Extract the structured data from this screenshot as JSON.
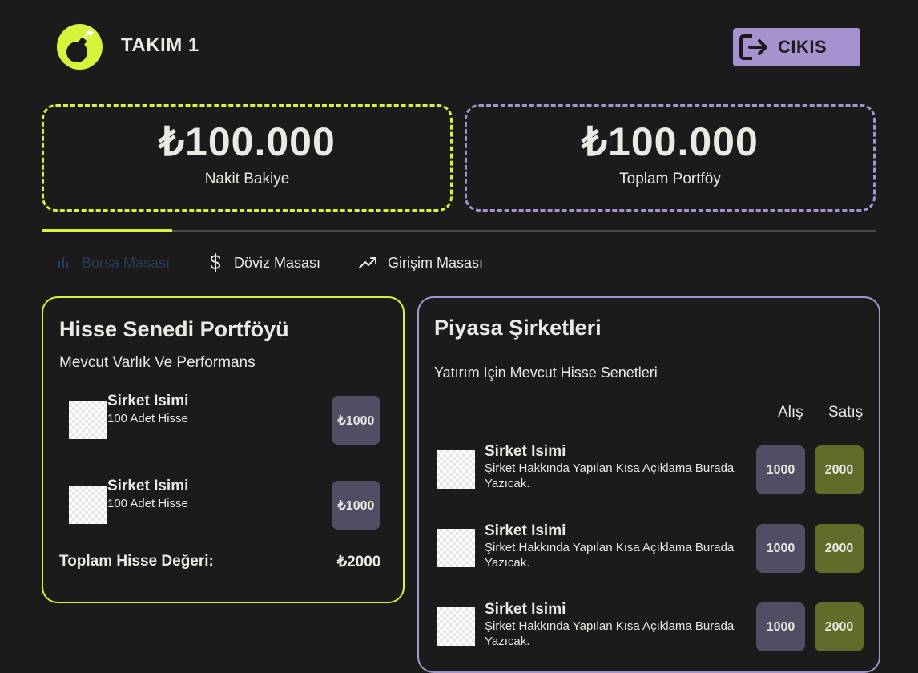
{
  "header": {
    "team_name": "TAKIM 1",
    "logout_label": "CIKIS"
  },
  "balances": {
    "cash_amount": "₺100.000",
    "cash_label": "Nakit Bakiye",
    "portfolio_amount": "₺100.000",
    "portfolio_label": "Toplam Portföy"
  },
  "tabs": [
    {
      "label": "Borsa Masası",
      "icon": "chart-bars-icon",
      "active": true
    },
    {
      "label": "Döviz Masası",
      "icon": "dollar-icon",
      "active": false
    },
    {
      "label": "Girişim Masası",
      "icon": "trending-up-icon",
      "active": false
    }
  ],
  "portfolio": {
    "title": "Hisse Senedi Portföyü",
    "subtitle": "Mevcut Varlık Ve Performans",
    "items": [
      {
        "name": "Sirket Isimi",
        "detail": "100 Adet Hisse",
        "value": "₺1000"
      },
      {
        "name": "Sirket Isimi",
        "detail": "100 Adet Hisse",
        "value": "₺1000"
      }
    ],
    "total_label": "Toplam Hisse Değeri:",
    "total_value": "₺2000"
  },
  "market": {
    "title": "Piyasa Şirketleri",
    "subtitle": "Yatırım Için Mevcut Hisse Senetleri",
    "buy_header": "Alış",
    "sell_header": "Satış",
    "items": [
      {
        "name": "Sirket Isimi",
        "description": "Şirket Hakkında Yapılan Kısa Açıklama Burada Yazıcak.",
        "buy": "1000",
        "sell": "2000"
      },
      {
        "name": "Sirket Isimi",
        "description": "Şirket Hakkında Yapılan Kısa Açıklama Burada Yazıcak.",
        "buy": "1000",
        "sell": "2000"
      },
      {
        "name": "Sirket Isimi",
        "description": "Şirket Hakkında Yapılan Kısa Açıklama Burada Yazıcak.",
        "buy": "1000",
        "sell": "2000"
      }
    ]
  },
  "colors": {
    "background": "#1c1b1c",
    "accent_lime": "#d4f53c",
    "accent_purple": "#a692cf",
    "buy_button": "#524c64",
    "sell_button": "#5f6c2a"
  }
}
